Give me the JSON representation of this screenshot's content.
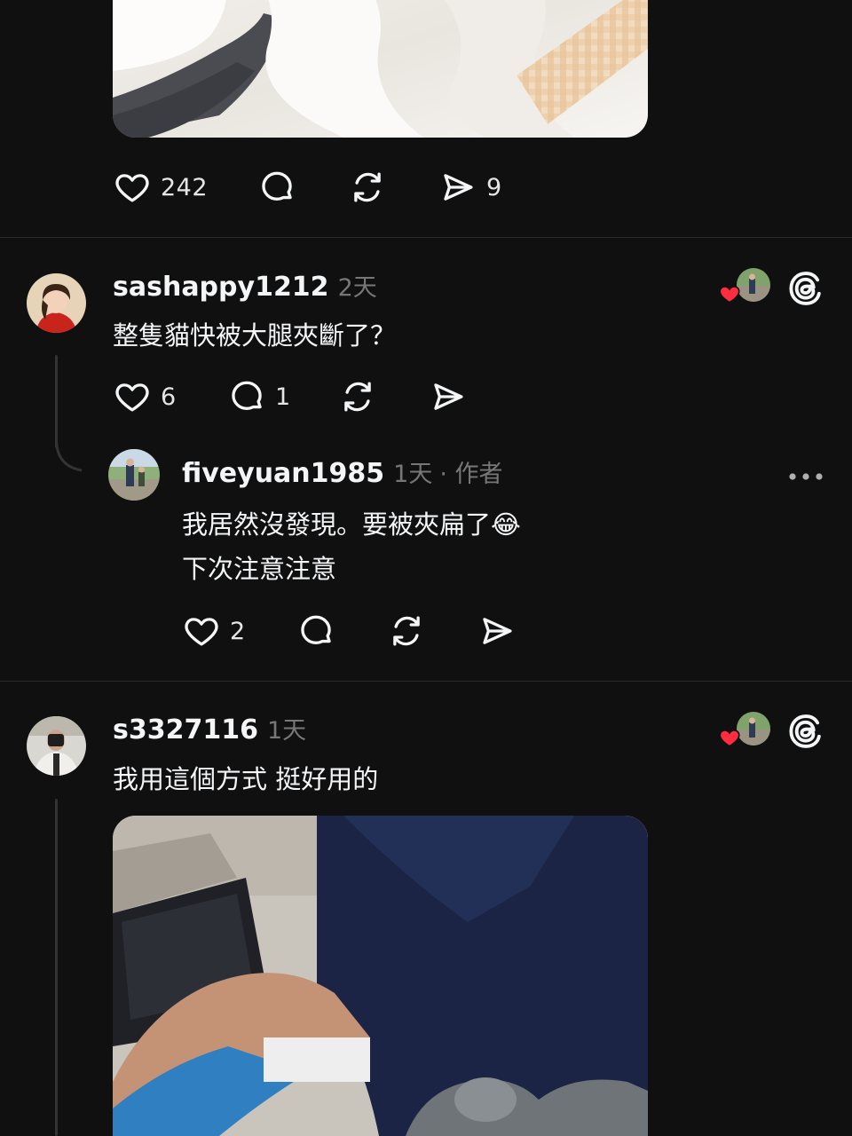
{
  "top_post": {
    "likes": "242",
    "shares": "9"
  },
  "comments": [
    {
      "username": "sashappy1212",
      "time": "2天",
      "text": "整隻貓快被大腿夾斷了？",
      "likes": "6",
      "replies": "1"
    },
    {
      "username": "fiveyuan1985",
      "time": "1天",
      "author_tag": "· 作者",
      "text_line1": "我居然沒發現。要被夾扁了😂",
      "text_line2": "下次注意注意",
      "likes": "2"
    },
    {
      "username": "s3327116",
      "time": "1天",
      "text": "我用這個方式 挺好用的"
    }
  ],
  "colors": {
    "background": "#101010",
    "text": "#f3f5f7",
    "secondary": "#777777",
    "divider": "#2b2b2b",
    "like_red": "#ff2d3f"
  }
}
